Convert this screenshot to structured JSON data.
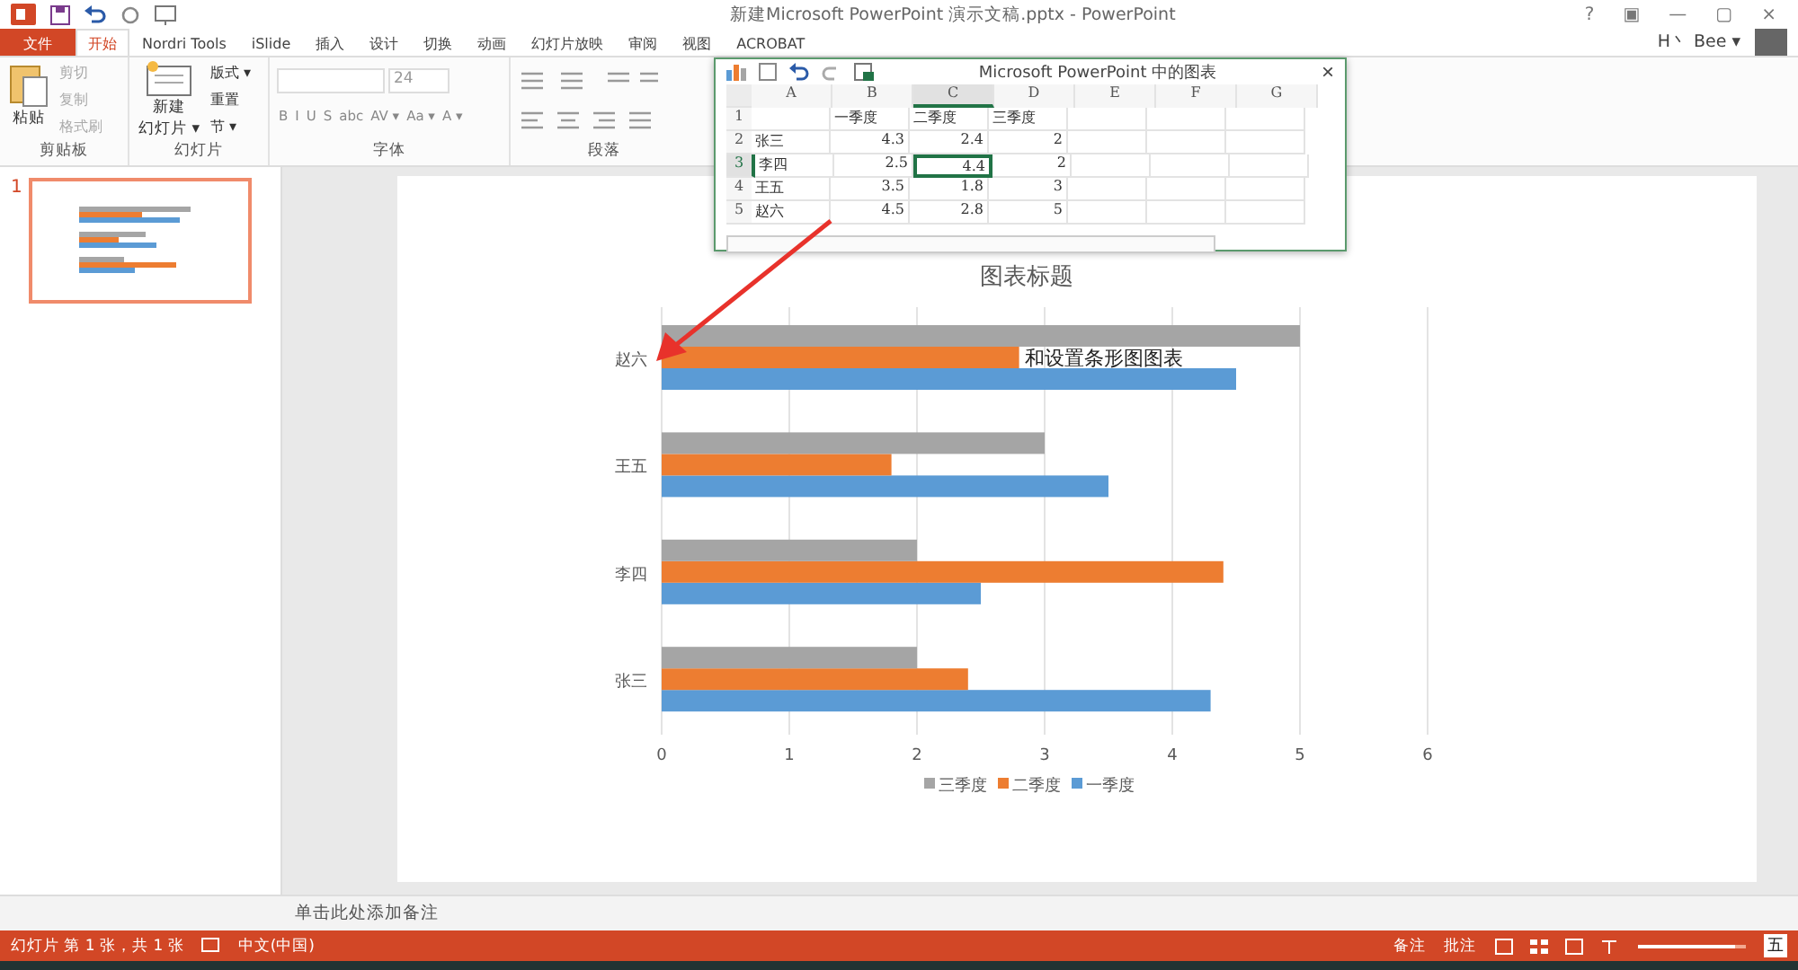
{
  "window": {
    "title": "新建Microsoft PowerPoint 演示文稿.pptx - PowerPoint",
    "controls": [
      "?",
      "▣",
      "—",
      "▢",
      "×"
    ]
  },
  "account": {
    "name": "H丶 Bee ▾"
  },
  "tabs": [
    {
      "label": "文件",
      "kind": "file",
      "selected": false
    },
    {
      "label": "开始",
      "kind": "tab",
      "selected": true
    },
    {
      "label": "Nordri Tools",
      "kind": "tab",
      "selected": false
    },
    {
      "label": "iSlide",
      "kind": "tab",
      "selected": false
    },
    {
      "label": "插入",
      "kind": "tab",
      "selected": false
    },
    {
      "label": "设计",
      "kind": "tab",
      "selected": false
    },
    {
      "label": "切换",
      "kind": "tab",
      "selected": false
    },
    {
      "label": "动画",
      "kind": "tab",
      "selected": false
    },
    {
      "label": "幻灯片放映",
      "kind": "tab",
      "selected": false
    },
    {
      "label": "审阅",
      "kind": "tab",
      "selected": false
    },
    {
      "label": "视图",
      "kind": "tab",
      "selected": false
    },
    {
      "label": "ACROBAT",
      "kind": "tab",
      "selected": false
    }
  ],
  "clipboard": {
    "label": "剪贴板",
    "paste": "粘贴",
    "items": [
      "剪切",
      "复制",
      "格式刷"
    ]
  },
  "slides_group": {
    "label": "幻灯片",
    "new_slide": [
      "新建",
      "幻灯片 ▾"
    ],
    "items": [
      "版式 ▾",
      "重置",
      "节 ▾"
    ]
  },
  "font_group": {
    "label": "字体",
    "size": "24",
    "buttons": [
      "B",
      "I",
      "U",
      "S",
      "abc",
      "AV ▾",
      "Aa ▾",
      "A ▾"
    ]
  },
  "paragraph_group": {
    "label": "段落"
  },
  "slide_panel": {
    "number": "1"
  },
  "chart": {
    "chart_data": {
      "type": "bar",
      "orientation": "horizontal",
      "title": "图表标题",
      "categories": [
        "赵六",
        "王五",
        "李四",
        "张三"
      ],
      "series": [
        {
          "name": "一季度",
          "color": "#5b9bd5",
          "values": [
            4.5,
            3.5,
            2.5,
            4.3
          ]
        },
        {
          "name": "二季度",
          "color": "#ed7d31",
          "values": [
            2.8,
            1.8,
            4.4,
            2.4
          ]
        },
        {
          "name": "三季度",
          "color": "#a5a5a5",
          "values": [
            5,
            3,
            2,
            2
          ]
        }
      ],
      "xlim": [
        0,
        6
      ],
      "xticks": [
        0,
        1,
        2,
        3,
        4,
        5,
        6
      ],
      "grid": true,
      "legend": true
    },
    "overlay_text": "和设置条形图图表"
  },
  "spreadsheet": {
    "title": "Microsoft PowerPoint 中的图表",
    "close": "×",
    "columns": [
      {
        "label": "A",
        "selected": false
      },
      {
        "label": "B",
        "selected": false
      },
      {
        "label": "C",
        "selected": true
      },
      {
        "label": "D",
        "selected": false
      },
      {
        "label": "E",
        "selected": false
      },
      {
        "label": "F",
        "selected": false
      },
      {
        "label": "G",
        "selected": false
      }
    ],
    "rows": [
      {
        "number": "1",
        "selected": false,
        "cells": [
          "",
          "一季度",
          "二季度",
          "三季度"
        ]
      },
      {
        "number": "2",
        "selected": false,
        "cells": [
          "张三",
          "4.3",
          "2.4",
          "2"
        ]
      },
      {
        "number": "3",
        "selected": true,
        "cells": [
          "李四",
          "2.5",
          "4.4",
          "2"
        ]
      },
      {
        "number": "4",
        "selected": false,
        "cells": [
          "王五",
          "3.5",
          "1.8",
          "3"
        ]
      },
      {
        "number": "5",
        "selected": false,
        "cells": [
          "赵六",
          "4.5",
          "2.8",
          "5"
        ]
      }
    ]
  },
  "notes": {
    "placeholder": "单击此处添加备注"
  },
  "status_bar": {
    "slide_info": "幻灯片 第 1 张，共 1 张",
    "language": "中文(中国)",
    "notes": "备注",
    "comments": "批注",
    "zoom": {
      "level": 0.9
    },
    "ime": "五"
  }
}
